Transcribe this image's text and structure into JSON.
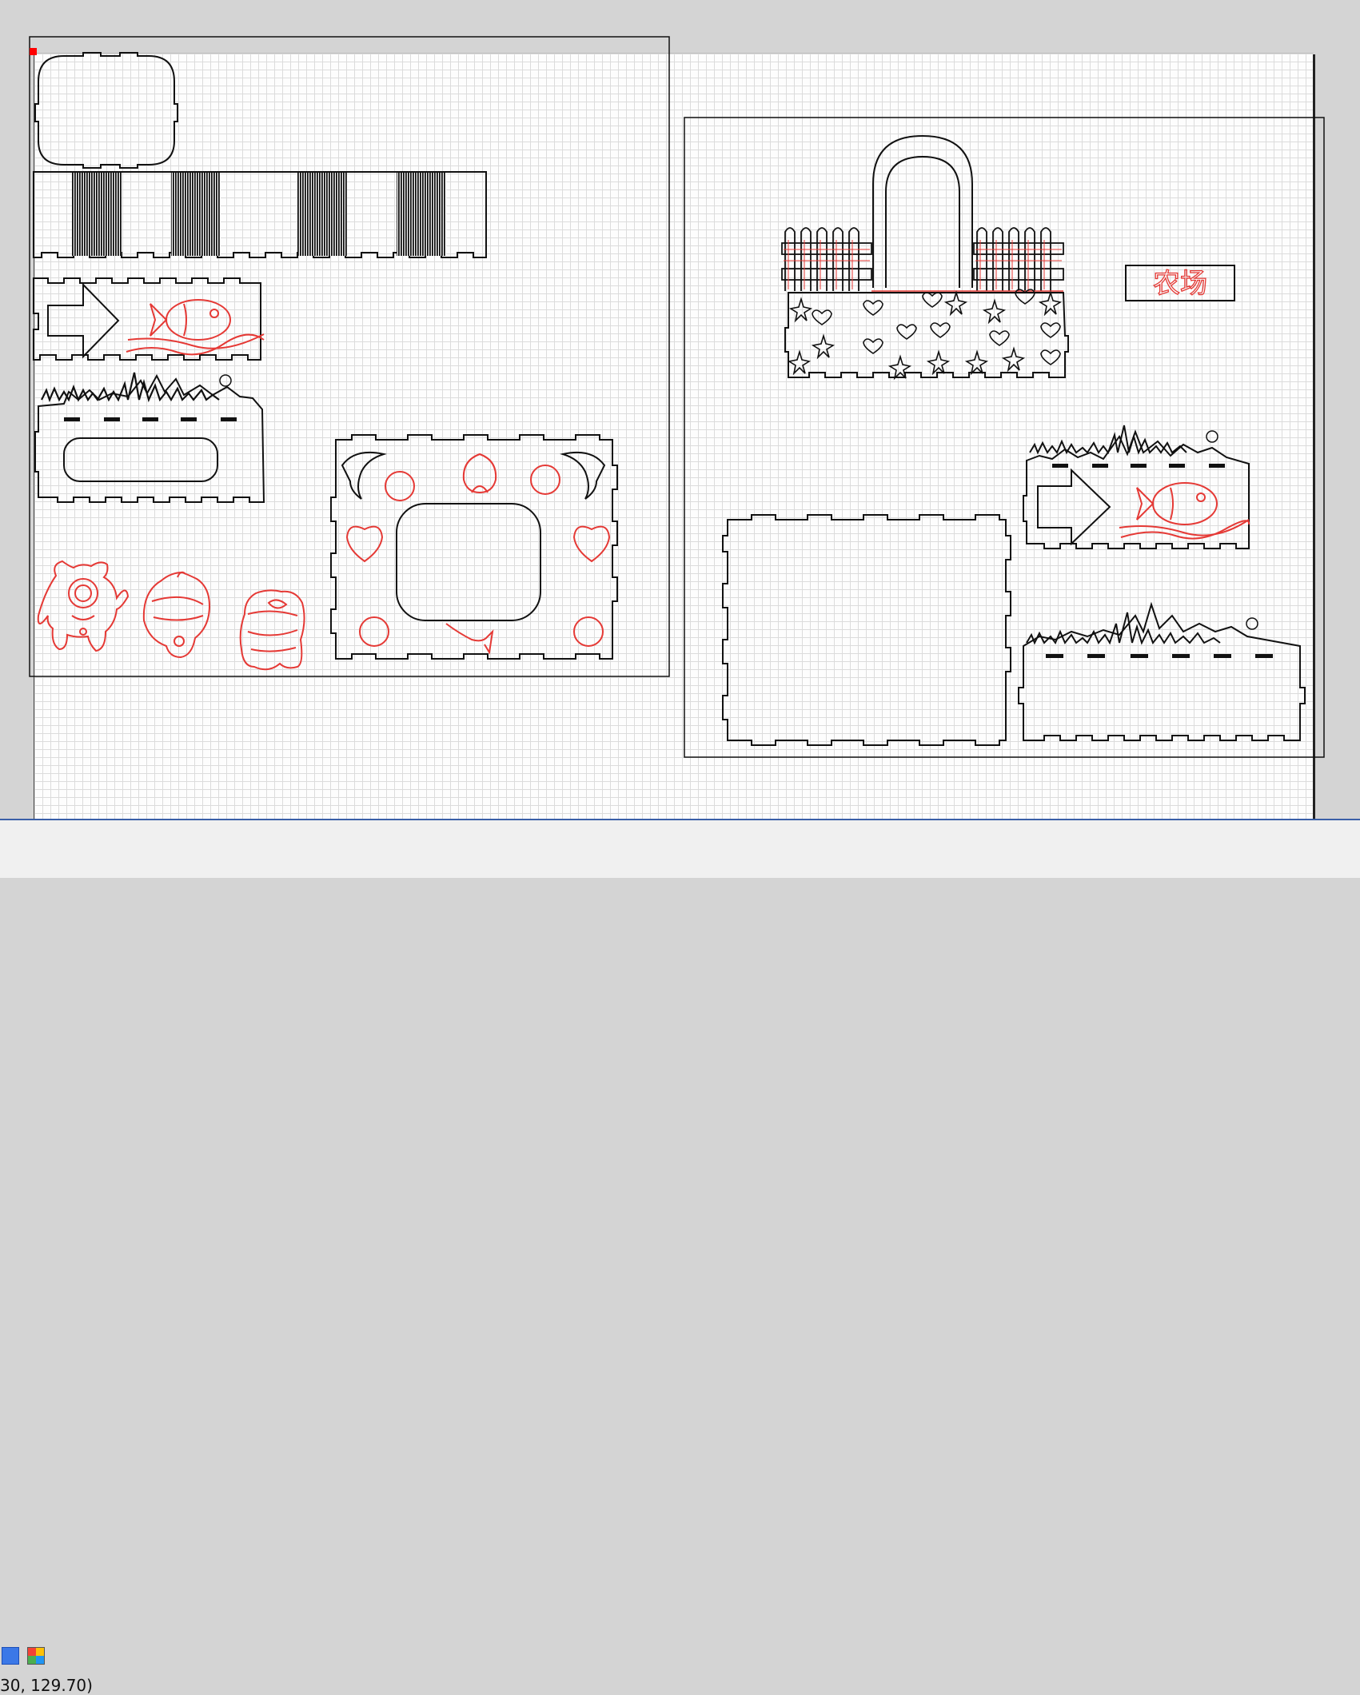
{
  "canvas": {
    "cut_line_color": "#111111",
    "engrave_line_color": "#e53935",
    "origin_marker_color": "#ff0000",
    "sign_text": "农场"
  },
  "status_bar": {
    "coordinates": "30, 129.70)",
    "buttons": [
      {
        "name": "blue-layer-button",
        "color": "#3b78e7"
      },
      {
        "name": "color-palette-button",
        "colors": [
          "#f44336",
          "#ffc107",
          "#4caf50",
          "#2196f3"
        ]
      }
    ]
  }
}
